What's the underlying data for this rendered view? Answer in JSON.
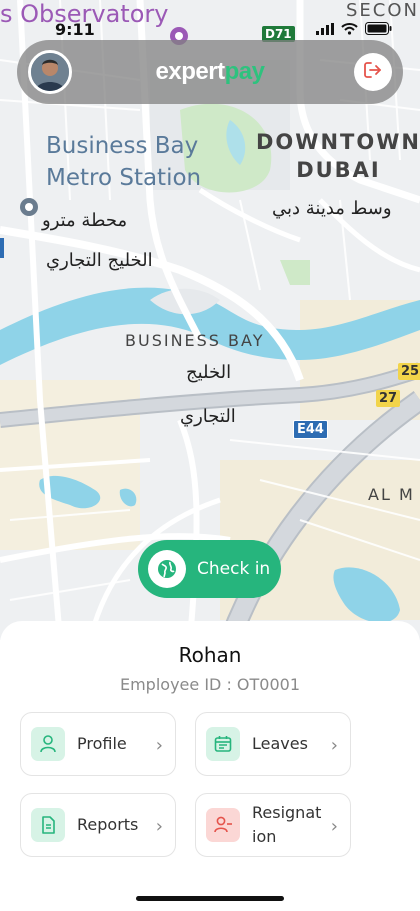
{
  "status_bar": {
    "time": "9:11"
  },
  "map": {
    "labels": {
      "observatory": "s Observatory",
      "metro": [
        "Business Bay",
        "Metro Station"
      ],
      "downtown": [
        "DOWNTOWN",
        "DUBAI"
      ],
      "second": "SECON",
      "business_bay": "BUSINESS BAY",
      "al_m": "AL M",
      "arabic_metro": "محطة مترو",
      "arabic_metro2": "الخليج التجاري",
      "arabic_downtown": "وسط مدينة دبي",
      "arabic_bb1": "الخليج",
      "arabic_bb2": "التجاري"
    },
    "shields": {
      "e44": "E44",
      "r27": "27",
      "r25": "25",
      "d71": "D71"
    }
  },
  "header": {
    "logo_part1": "expert",
    "logo_part2": "pay",
    "logout_icon": "logout-icon"
  },
  "checkin": {
    "label": "Check in"
  },
  "employee": {
    "name": "Rohan",
    "id_text": "Employee ID : OT0001"
  },
  "menu": {
    "profile": "Profile",
    "leaves": "Leaves",
    "reports": "Reports",
    "resignation_line1": "Resignat",
    "resignation_line2": "ion"
  },
  "colors": {
    "accent": "#26b57d",
    "header_bg": "#828282",
    "danger": "#e5534b"
  }
}
